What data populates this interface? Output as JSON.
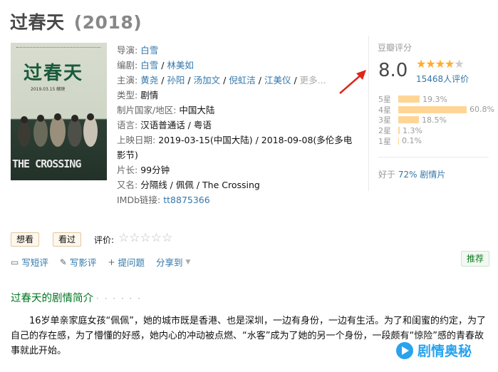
{
  "page": {
    "title": "过春天",
    "year": "(2018)"
  },
  "poster": {
    "title": "过春天",
    "date": "2019.03.15 献映",
    "english": "THE CROSSING"
  },
  "info": {
    "director_label": "导演:",
    "director": "白雪",
    "writer_label": "编剧:",
    "writers": [
      "白雪",
      "林美如"
    ],
    "cast_label": "主演:",
    "cast": [
      "黄尧",
      "孙阳",
      "汤加文",
      "倪虹洁",
      "江美仪"
    ],
    "cast_more": "更多...",
    "genre_label": "类型:",
    "genre": "剧情",
    "country_label": "制片国家/地区:",
    "country": "中国大陆",
    "language_label": "语言:",
    "language": "汉语普通话 / 粤语",
    "release_label": "上映日期:",
    "release_line1": "2019-03-15(中国大陆) / 2018-09-08(多伦多电",
    "release_line2": "影节)",
    "runtime_label": "片长:",
    "runtime": "99分钟",
    "aka_label": "又名:",
    "aka": "分隔线 / 佩佩 / The Crossing",
    "imdb_label": "IMDb链接:",
    "imdb": "tt8875366"
  },
  "rating": {
    "label": "豆瓣评分",
    "score": "8.0",
    "stars_value": 4,
    "count": "15468人评价",
    "distribution": [
      {
        "label": "5星",
        "pct": "19.3%",
        "value": 19.3
      },
      {
        "label": "4星",
        "pct": "60.8%",
        "value": 60.8
      },
      {
        "label": "3星",
        "pct": "18.5%",
        "value": 18.5
      },
      {
        "label": "2星",
        "pct": "1.3%",
        "value": 1.3
      },
      {
        "label": "1星",
        "pct": "0.1%",
        "value": 0.1
      }
    ],
    "better_prefix": "好于",
    "better_link": "72% 剧情片"
  },
  "actions": {
    "want": "想看",
    "seen": "看过",
    "rate_label": "评价:",
    "short_review": "写短评",
    "long_review": "写影评",
    "ask": "提问题",
    "share": "分享到",
    "recommend": "推荐"
  },
  "synopsis": {
    "heading": "过春天的剧情简介",
    "dots": "· · · · · ·",
    "text": "16岁单亲家庭女孩“佩佩”，她的城市既是香港、也是深圳，一边有身份，一边有生活。为了和闺蜜的约定，为了自己的存在感，为了懵懂的好感，她内心的冲动被点燃、“水客”成为了她的另一个身份，一段颇有“惊险”感的青春故事就此开始。"
  },
  "watermark": {
    "text": "剧情奥秘"
  },
  "colors": {
    "link": "#3377aa",
    "green": "#007722",
    "star": "#ffac2d",
    "bar": "#ffd596",
    "arrow": "#e0261b"
  }
}
